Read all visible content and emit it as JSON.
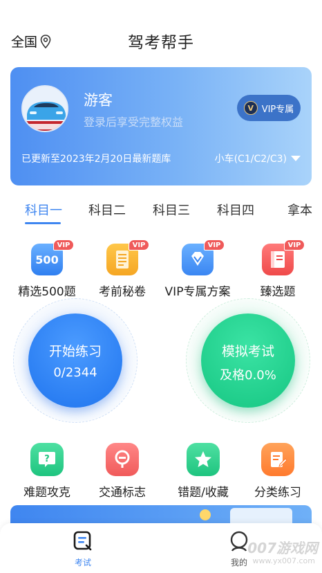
{
  "header": {
    "region": "全国",
    "title": "驾考帮手"
  },
  "user_card": {
    "name": "游客",
    "subtitle": "登录后享受完整权益",
    "vip_label": "VIP专属",
    "vip_coin": "V",
    "update_text": "已更新至2023年2月20日最新题库",
    "car_type": "小车(C1/C2/C3)"
  },
  "tabs": [
    {
      "label": "科目一",
      "active": true
    },
    {
      "label": "科目二",
      "active": false
    },
    {
      "label": "科目三",
      "active": false
    },
    {
      "label": "科目四",
      "active": false
    },
    {
      "label": "拿本",
      "active": false
    }
  ],
  "features_top": [
    {
      "label": "精选500题",
      "icon": "500-icon",
      "icon_text": "500",
      "badge": "VIP"
    },
    {
      "label": "考前秘卷",
      "icon": "document-icon",
      "badge": "VIP"
    },
    {
      "label": "VIP专属方案",
      "icon": "diamond-icon",
      "badge": "VIP"
    },
    {
      "label": "臻选题",
      "icon": "book-icon",
      "badge": "VIP"
    }
  ],
  "practice": {
    "label": "开始练习",
    "progress": "0/2344"
  },
  "mock_exam": {
    "label": "模拟考试",
    "pass_rate": "及格0.0%"
  },
  "features_bottom": [
    {
      "label": "难题攻克",
      "icon": "question-icon"
    },
    {
      "label": "交通标志",
      "icon": "traffic-sign-icon"
    },
    {
      "label": "错题/收藏",
      "icon": "star-icon"
    },
    {
      "label": "分类练习",
      "icon": "edit-icon"
    }
  ],
  "bottom_nav": {
    "exam": "考试",
    "mine": "我的"
  },
  "watermark": {
    "brand": "007游戏网",
    "url": "www.yx007.com"
  },
  "colors": {
    "accent": "#3f86f0",
    "green": "#1fc47f",
    "red": "#ef5a5a",
    "orange": "#ff7a2e"
  }
}
